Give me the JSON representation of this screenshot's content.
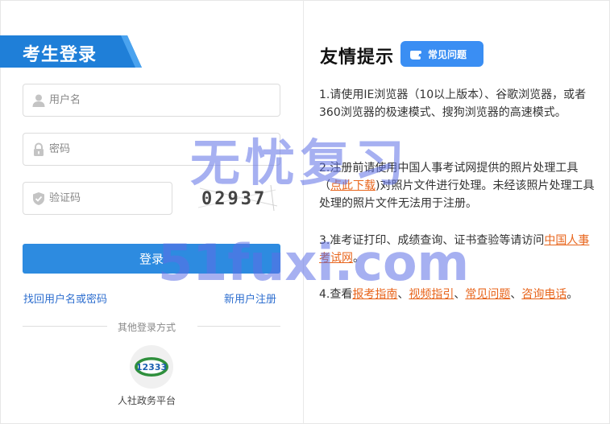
{
  "login": {
    "title": "考生登录",
    "username_placeholder": "用户名",
    "password_placeholder": "密码",
    "captcha_placeholder": "验证码",
    "captcha_text": "02937",
    "login_button": "登录",
    "forgot_link": "找回用户名或密码",
    "register_link": "新用户注册",
    "other_methods": "其他登录方式",
    "platform_label": "人社政务平台",
    "platform_logo_text": "12333"
  },
  "tips": {
    "title": "友情提示",
    "faq_button": "常见问题",
    "tip1": "1.请使用IE浏览器（10以上版本）、谷歌浏览器，或者360浏览器的极速模式、搜狗浏览器的高速模式。",
    "tip2_before": "2.注册前请使用中国人事考试网提供的照片处理工具（",
    "tip2_link": "点此下载",
    "tip2_after": ")对照片文件进行处理。未经该照片处理工具处理的照片文件无法用于注册。",
    "tip3_before": "3.准考证打印、成绩查询、证书查验等请访问",
    "tip3_link": "中国人事考试网",
    "tip3_after": "。",
    "tip4_before": "4.查看",
    "tip4_link1": "报考指南",
    "sep1": "、",
    "tip4_link2": "视频指引",
    "sep2": "、",
    "tip4_link3": "常见问题",
    "sep3": "、",
    "tip4_link4": "咨询电话",
    "tip4_after": "。"
  },
  "watermark": {
    "line1": "无忧复习",
    "line2": "51fuxi.com"
  },
  "colors": {
    "primary_blue": "#2d8be0",
    "banner_blue": "#1f7fd8",
    "link_blue": "#2d6ecf",
    "link_orange": "#e8651c"
  },
  "icons": {
    "username": "user-icon",
    "password": "lock-icon",
    "captcha": "shield-icon",
    "faq": "hand-pointer-icon"
  }
}
